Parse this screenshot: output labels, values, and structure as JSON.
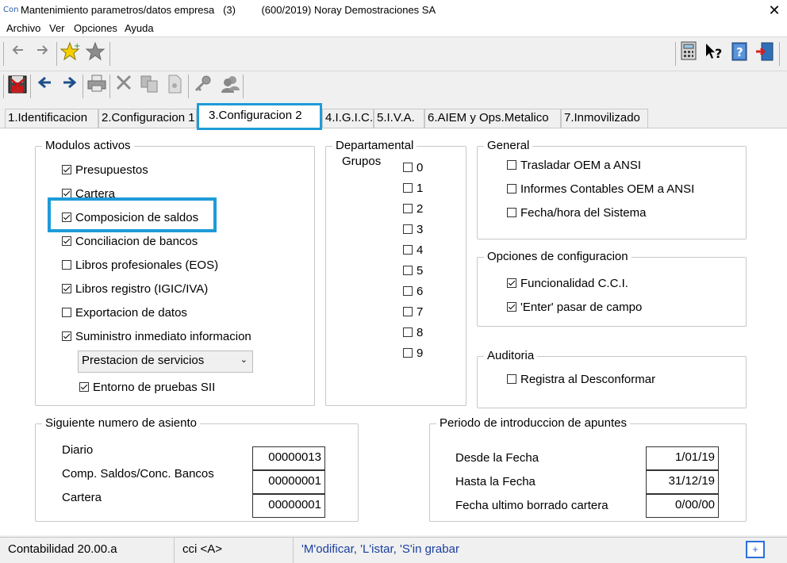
{
  "window": {
    "app_icon": "Con",
    "title": "Mantenimiento parametros/datos empresa   (3)         (600/2019) Noray Demostraciones SA",
    "close_symbol": "✕"
  },
  "menu": {
    "items": [
      "Archivo",
      "Ver",
      "Opciones",
      "Ayuda"
    ]
  },
  "toolbar1": {
    "icons": [
      "back-arrow-icon",
      "forward-arrow-icon",
      "favorite-star-icon",
      "favorites-list-icon",
      "calculator-icon",
      "context-help-icon",
      "help-book-icon",
      "exit-door-icon"
    ]
  },
  "toolbar2": {
    "icons": [
      "save-exit-icon",
      "previous-icon",
      "next-icon",
      "print-icon",
      "delete-icon",
      "copy-icon",
      "document-icon",
      "key-icon",
      "users-icon"
    ]
  },
  "tabs": [
    {
      "label": "1.Identificacion"
    },
    {
      "label": "2.Configuracion 1"
    },
    {
      "label": "3.Configuracion 2",
      "active": true
    },
    {
      "label": "4.I.G.I.C."
    },
    {
      "label": "5.I.V.A."
    },
    {
      "label": "6.AIEM y Ops.Metalico"
    },
    {
      "label": "7.Inmovilizado"
    }
  ],
  "modulos": {
    "title": "Modulos activos",
    "items": [
      {
        "label": "Presupuestos",
        "checked": true
      },
      {
        "label": "Cartera",
        "checked": true
      },
      {
        "label": "Composicion de saldos",
        "checked": true
      },
      {
        "label": "Conciliacion de bancos",
        "checked": true
      },
      {
        "label": "Libros profesionales (EOS)",
        "checked": false
      },
      {
        "label": "Libros registro (IGIC/IVA)",
        "checked": true
      },
      {
        "label": "Exportacion de datos",
        "checked": false
      },
      {
        "label": "Suministro inmediato informacion",
        "checked": true
      }
    ],
    "sii_select": "Prestacion de servicios",
    "entorno": {
      "label": "Entorno de pruebas SII",
      "checked": true
    }
  },
  "departamental": {
    "title": "Departamental",
    "subtitle": "Grupos",
    "groups": [
      "0",
      "1",
      "2",
      "3",
      "4",
      "5",
      "6",
      "7",
      "8",
      "9"
    ]
  },
  "general": {
    "title": "General",
    "items": [
      {
        "label": "Trasladar OEM a ANSI",
        "checked": false
      },
      {
        "label": "Informes Contables OEM a ANSI",
        "checked": false
      },
      {
        "label": "Fecha/hora del Sistema",
        "checked": false
      }
    ]
  },
  "opciones": {
    "title": "Opciones de configuracion",
    "items": [
      {
        "label": "Funcionalidad C.C.I.",
        "checked": true
      },
      {
        "label": "'Enter' pasar de campo",
        "checked": true
      }
    ]
  },
  "auditoria": {
    "title": "Auditoria",
    "items": [
      {
        "label": "Registra al Desconformar",
        "checked": false
      }
    ]
  },
  "asiento": {
    "title": "Siguiente numero de asiento",
    "rows": [
      {
        "label": "Diario",
        "value": "00000013"
      },
      {
        "label": "Comp. Saldos/Conc. Bancos",
        "value": "00000001"
      },
      {
        "label": "Cartera",
        "value": "00000001"
      }
    ]
  },
  "periodo": {
    "title": "Periodo de introduccion de apuntes",
    "rows": [
      {
        "label": "Desde la Fecha",
        "value": "1/01/19"
      },
      {
        "label": "Hasta la Fecha",
        "value": "31/12/19"
      },
      {
        "label": "Fecha ultimo borrado cartera",
        "value": "0/00/00"
      }
    ]
  },
  "status": {
    "version": "Contabilidad 20.00.a",
    "user": "cci <A>",
    "hint": "'M'odificar, 'L'istar, 'S'in grabar",
    "plus": "+"
  },
  "colors": {
    "highlight": "#1e9bd8",
    "hint_text": "#1a3fa0"
  }
}
